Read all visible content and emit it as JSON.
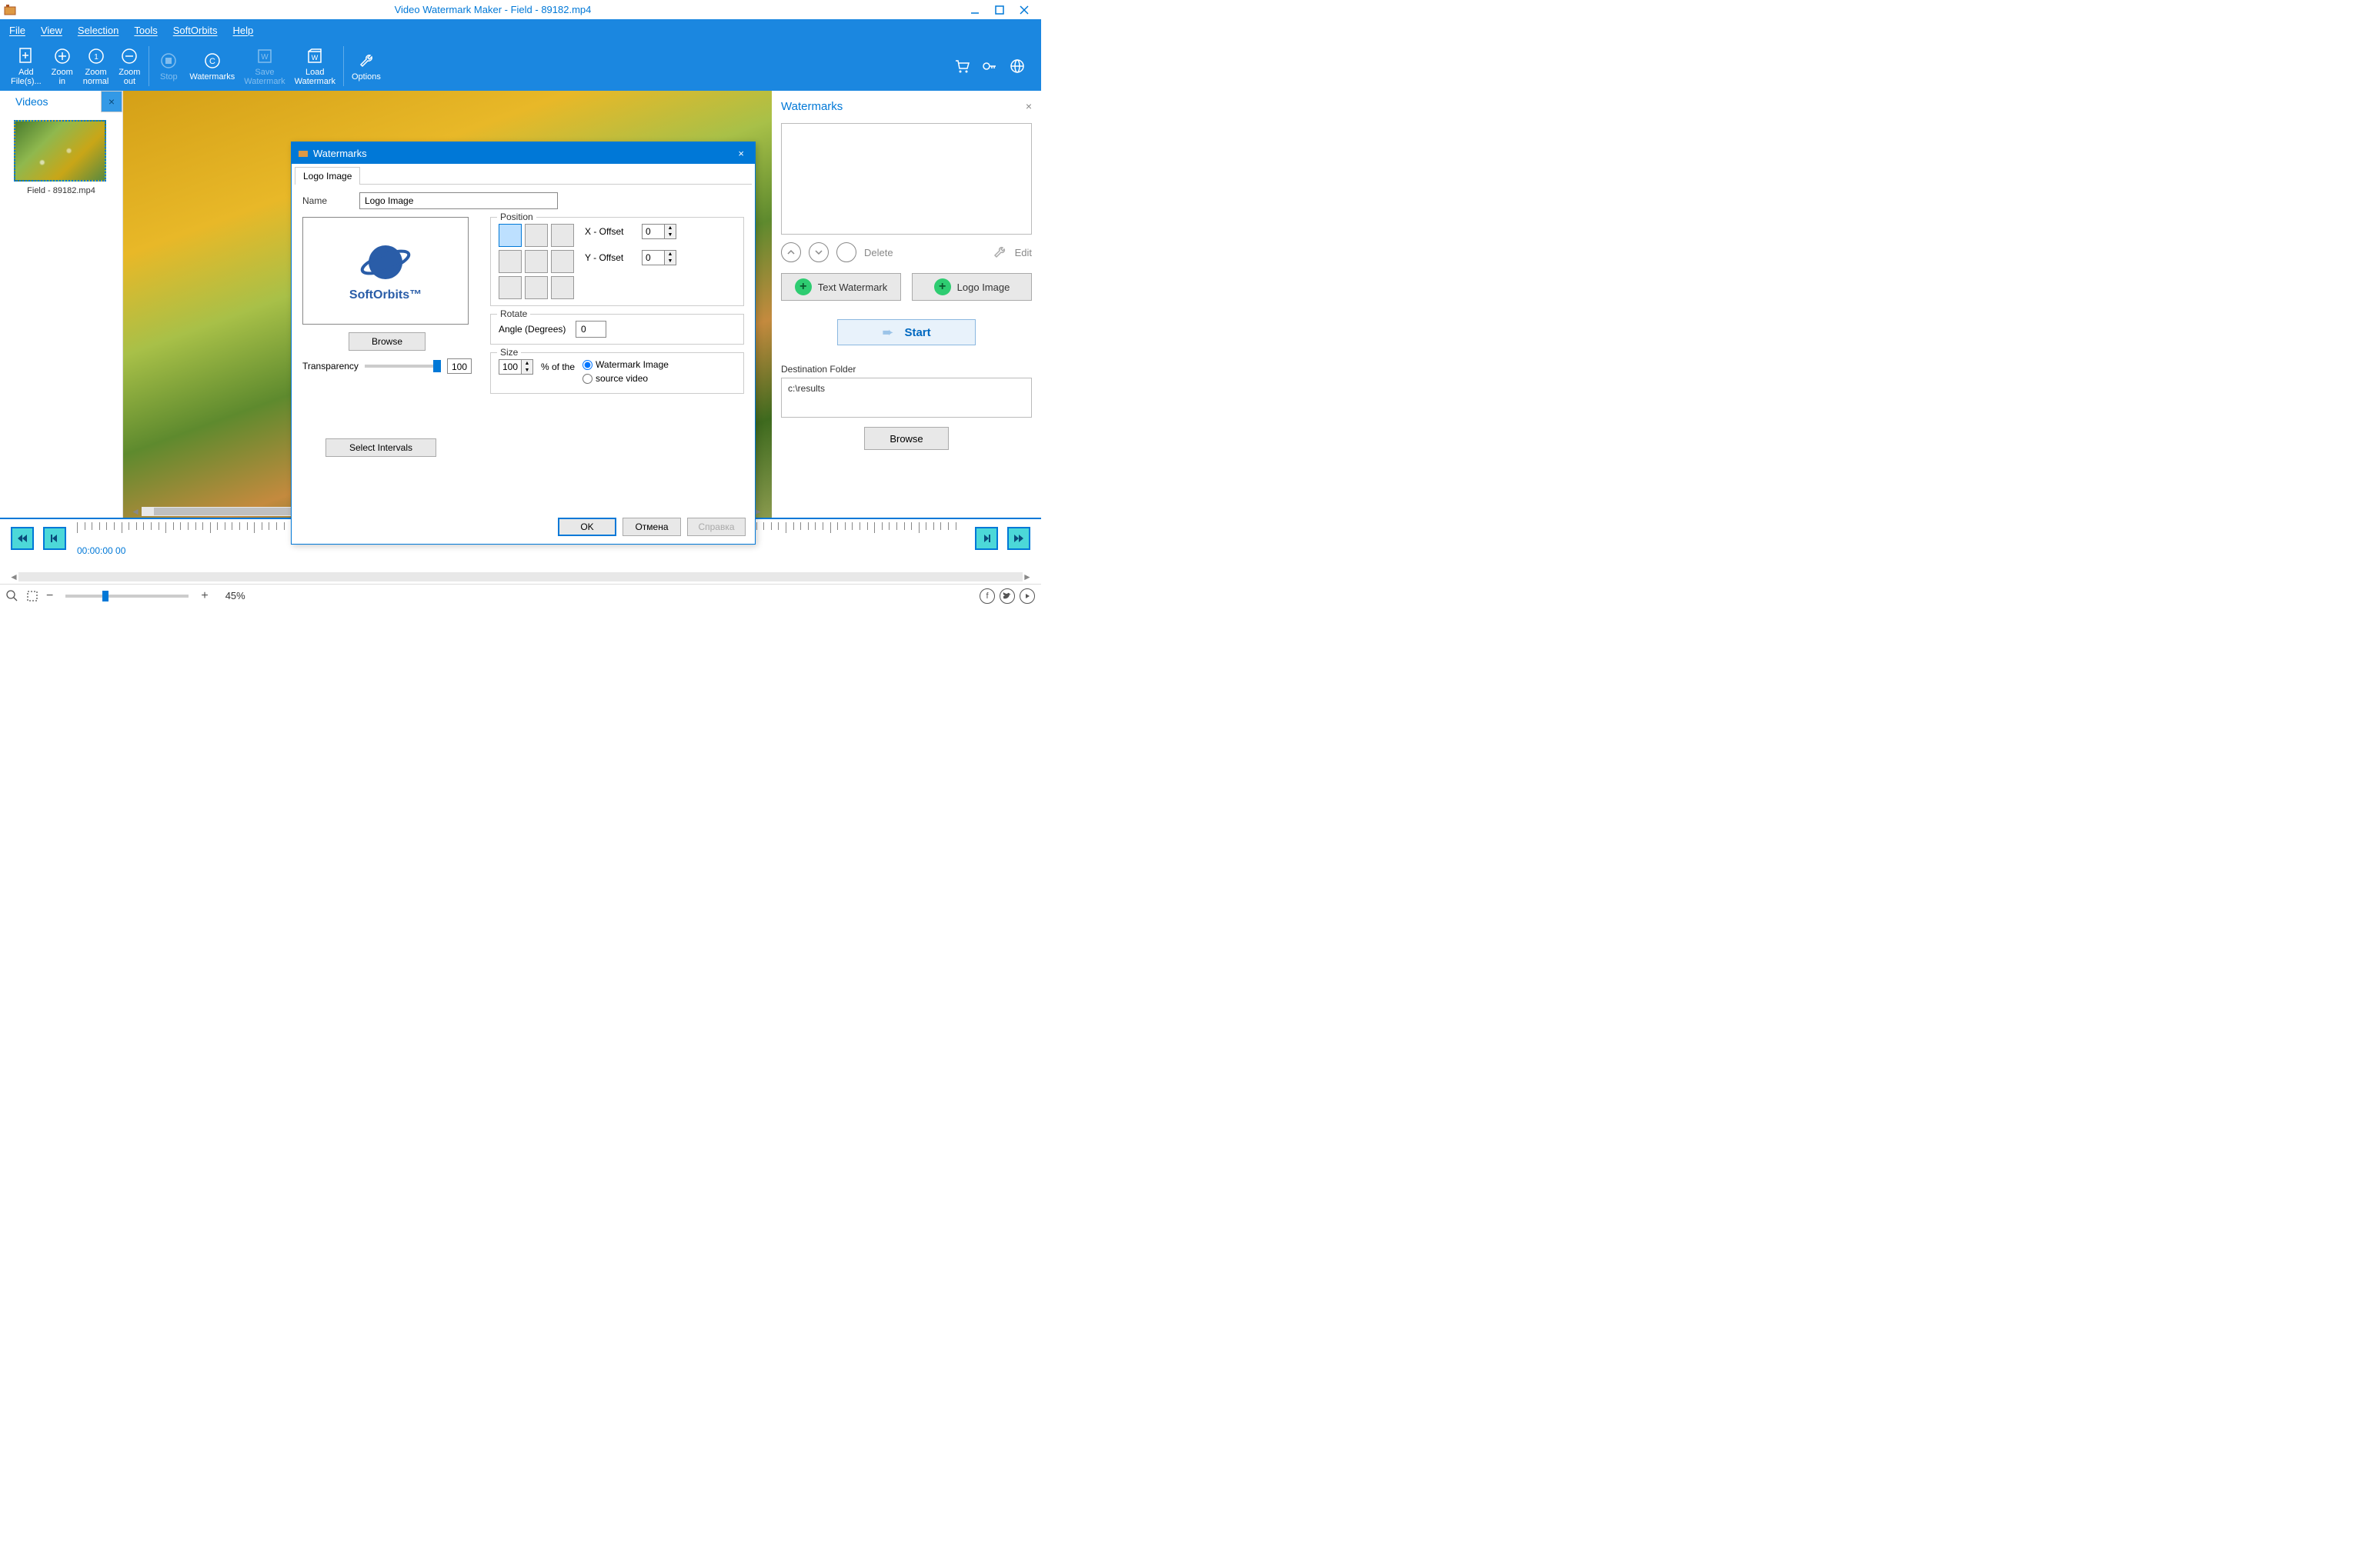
{
  "titlebar": {
    "title": "Video Watermark Maker - Field - 89182.mp4"
  },
  "menu": {
    "file": "File",
    "view": "View",
    "selection": "Selection",
    "tools": "Tools",
    "softorbits": "SoftOrbits",
    "help": "Help"
  },
  "toolbar": {
    "add_files": "Add\nFile(s)...",
    "zoom_in": "Zoom\nin",
    "zoom_normal": "Zoom\nnormal",
    "zoom_out": "Zoom\nout",
    "stop": "Stop",
    "watermarks": "Watermarks",
    "save_watermark": "Save\nWatermark",
    "load_watermark": "Load\nWatermark",
    "options": "Options"
  },
  "left": {
    "tab": "Videos",
    "thumb_caption": "Field - 89182.mp4"
  },
  "right": {
    "title": "Watermarks",
    "delete": "Delete",
    "edit": "Edit",
    "text_watermark": "Text Watermark",
    "logo_image": "Logo Image",
    "start": "Start",
    "dest_label": "Destination Folder",
    "dest_value": "c:\\results",
    "browse": "Browse"
  },
  "dialog": {
    "title": "Watermarks",
    "tab": "Logo Image",
    "name_label": "Name",
    "name_value": "Logo Image",
    "logo_text": "SoftOrbits™",
    "browse": "Browse",
    "transparency_label": "Transparency",
    "transparency_value": "100",
    "position_legend": "Position",
    "x_offset_label": "X - Offset",
    "x_offset_value": "0",
    "y_offset_label": "Y - Offset",
    "y_offset_value": "0",
    "rotate_legend": "Rotate",
    "angle_label": "Angle (Degrees)",
    "angle_value": "0",
    "size_legend": "Size",
    "size_value": "100",
    "size_pct_label": "% of the",
    "size_opt1": "Watermark Image",
    "size_opt2": "source video",
    "select_intervals": "Select Intervals",
    "ok": "OK",
    "cancel": "Отмена",
    "help": "Справка"
  },
  "timeline": {
    "time": "00:00:00 00"
  },
  "status": {
    "zoom_pct": "45%"
  }
}
